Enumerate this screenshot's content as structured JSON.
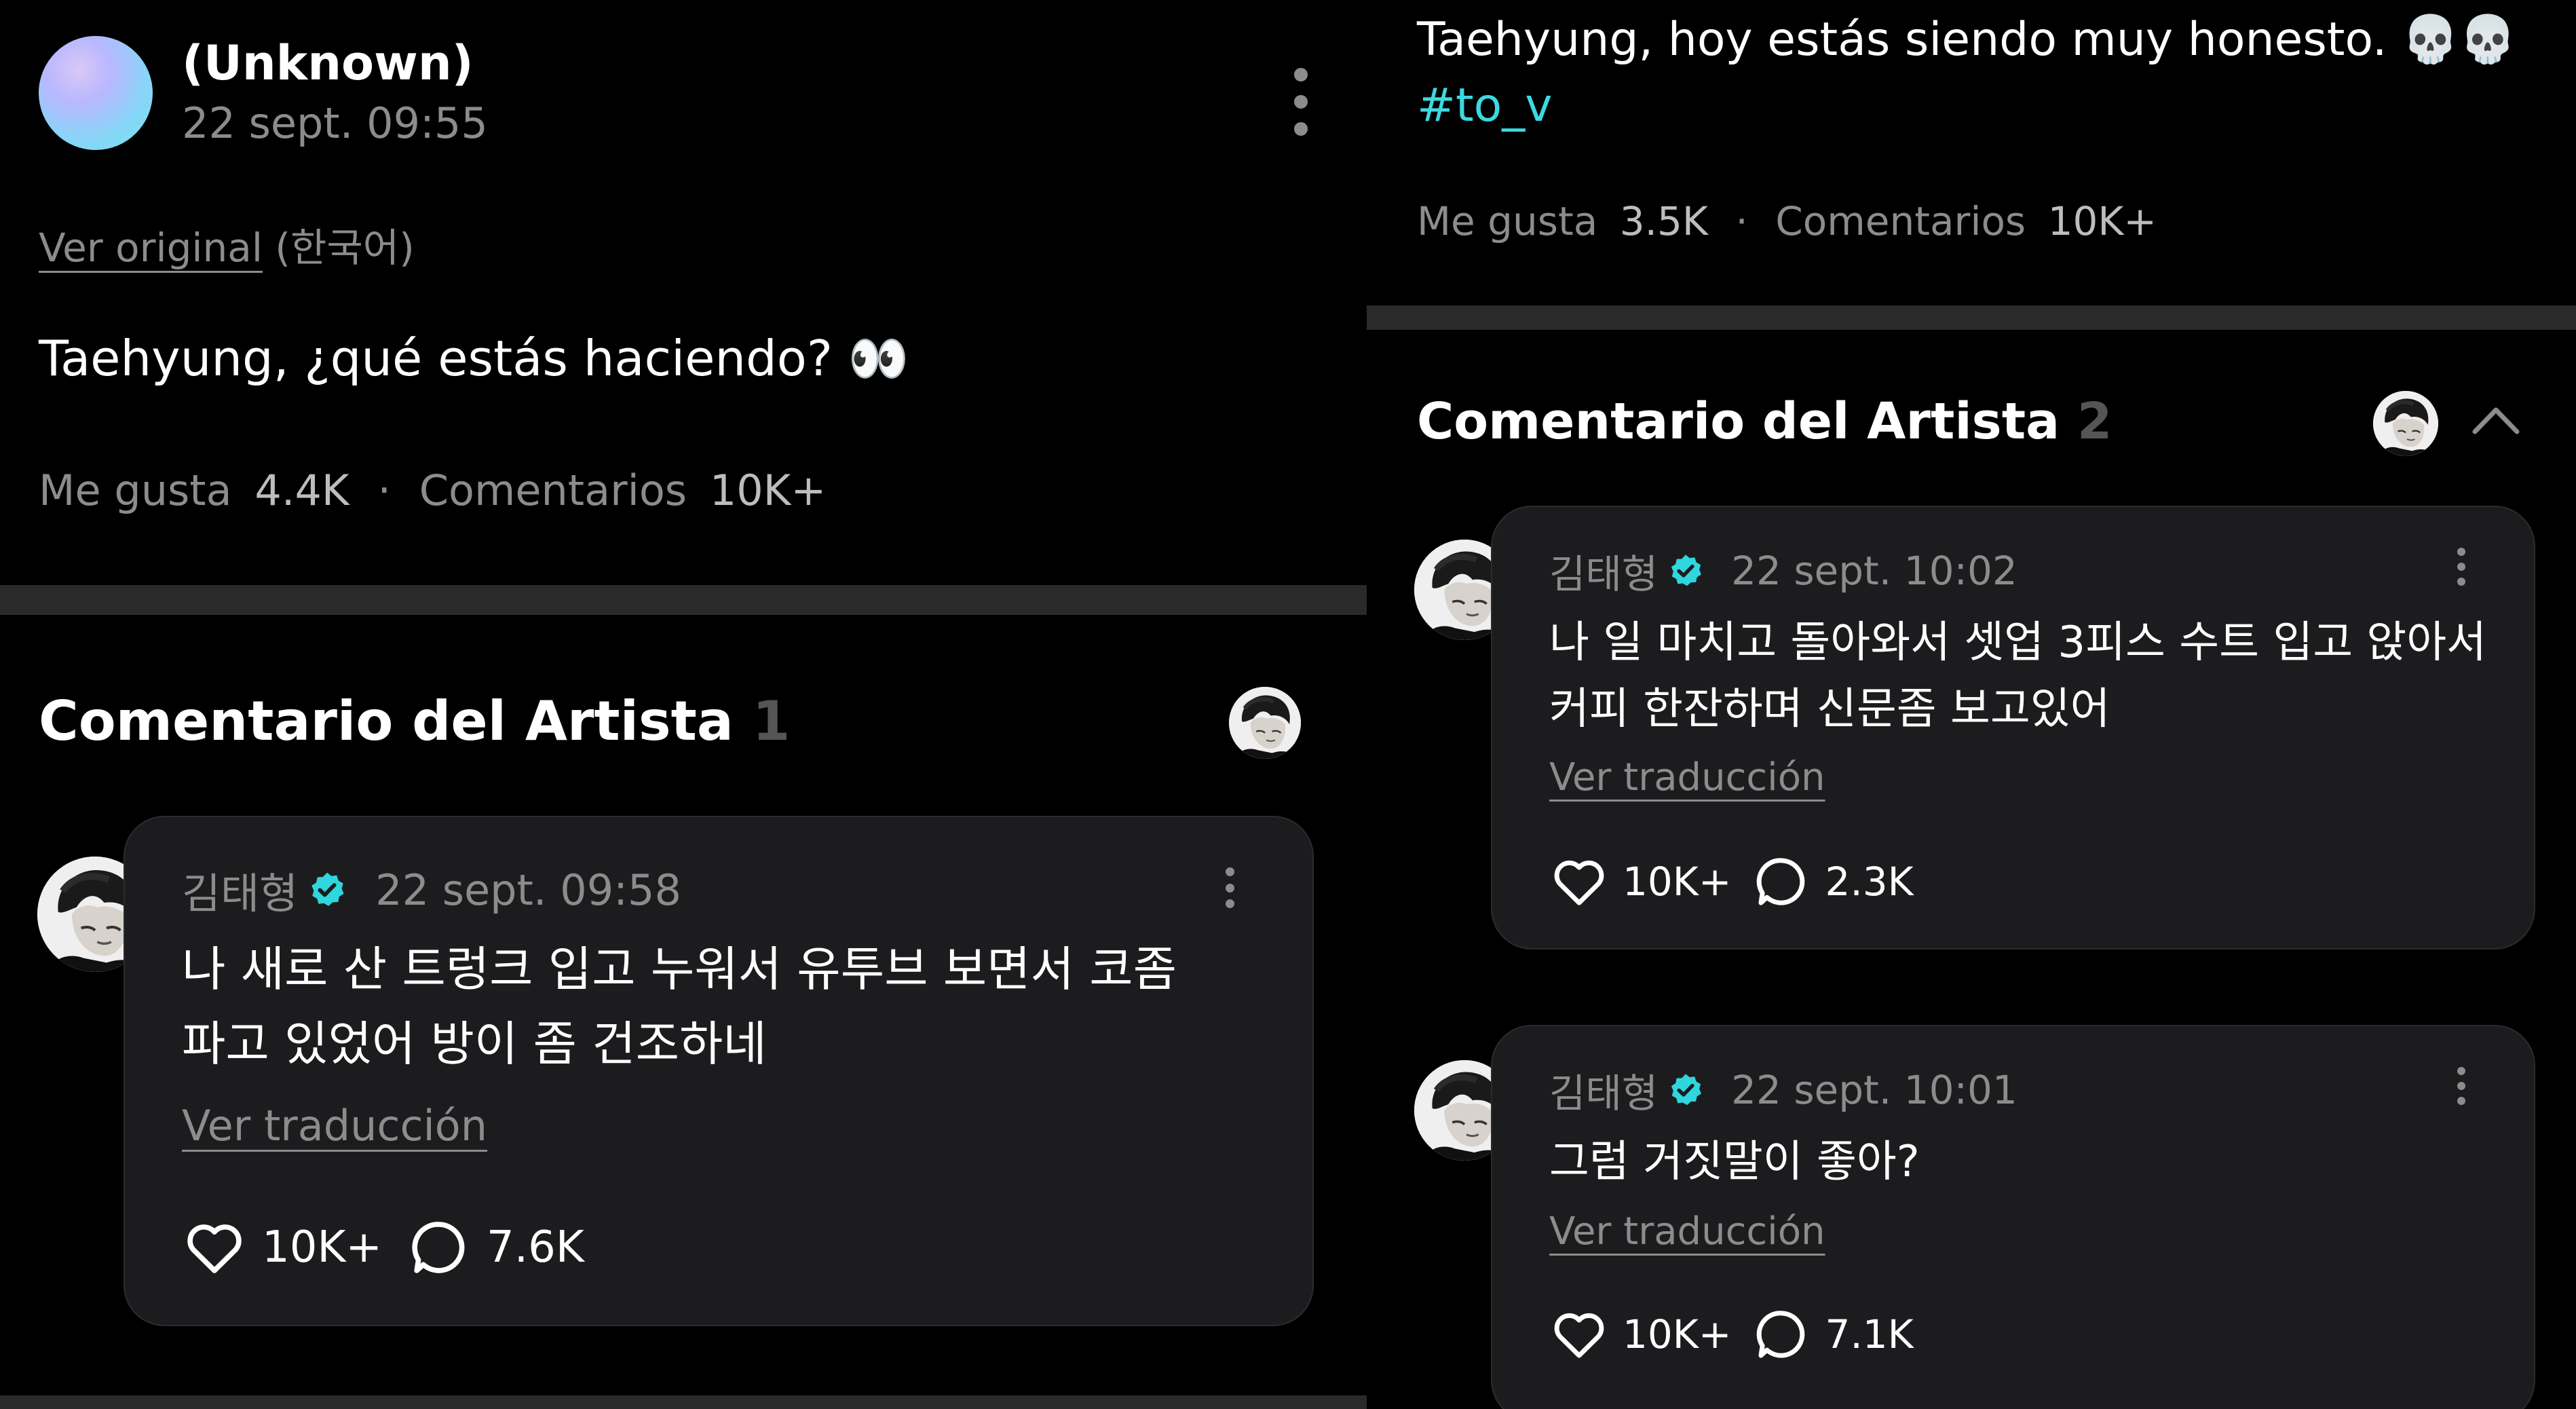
{
  "left": {
    "post": {
      "author": "(Unknown)",
      "timestamp": "22 sept. 09:55",
      "view_original": "Ver original",
      "original_lang": "(한국어)",
      "text": "Taehyung, ¿qué estás haciendo? 👀",
      "likes_label": "Me gusta",
      "likes_count": "4.4K",
      "separator": "·",
      "comments_label": "Comentarios",
      "comments_count": "10K+"
    },
    "artist_section": {
      "title": "Comentario del Artista",
      "count": "1"
    },
    "comments": [
      {
        "author": "김태형",
        "timestamp": "22 sept. 09:58",
        "text_line1": "나 새로 산 트렁크 입고 누워서 유투브 보면서 코좀",
        "text_line2": "파고 있었어 방이 좀 건조하네",
        "translate": "Ver traducción",
        "likes": "10K+",
        "replies": "7.6K"
      }
    ]
  },
  "right": {
    "post": {
      "text": "Taehyung, hoy estás siendo muy honesto. 💀💀",
      "hashtag": "#to_v",
      "likes_label": "Me gusta",
      "likes_count": "3.5K",
      "separator": "·",
      "comments_label": "Comentarios",
      "comments_count": "10K+"
    },
    "artist_section": {
      "title": "Comentario del Artista",
      "count": "2"
    },
    "comments": [
      {
        "author": "김태형",
        "timestamp": "22 sept. 10:02",
        "text_line1": "나 일 마치고 돌아와서 셋업 3피스 수트 입고 앉아서",
        "text_line2": "커피 한잔하며 신문좀 보고있어",
        "translate": "Ver traducción",
        "likes": "10K+",
        "replies": "2.3K"
      },
      {
        "author": "김태형",
        "timestamp": "22 sept. 10:01",
        "text_line1": "그럼 거짓말이 좋아?",
        "translate": "Ver traducción",
        "likes": "10K+",
        "replies": "7.1K"
      }
    ]
  },
  "colors": {
    "background": "#000000",
    "card": "#1c1c1e",
    "muted_text": "#8c8c8c",
    "verified": "#2fd6dd",
    "hashtag": "#3ed8df"
  },
  "icons": [
    "kebab-menu-icon",
    "heart-icon",
    "comment-bubble-icon",
    "verified-badge-icon",
    "chevron-up-icon"
  ]
}
